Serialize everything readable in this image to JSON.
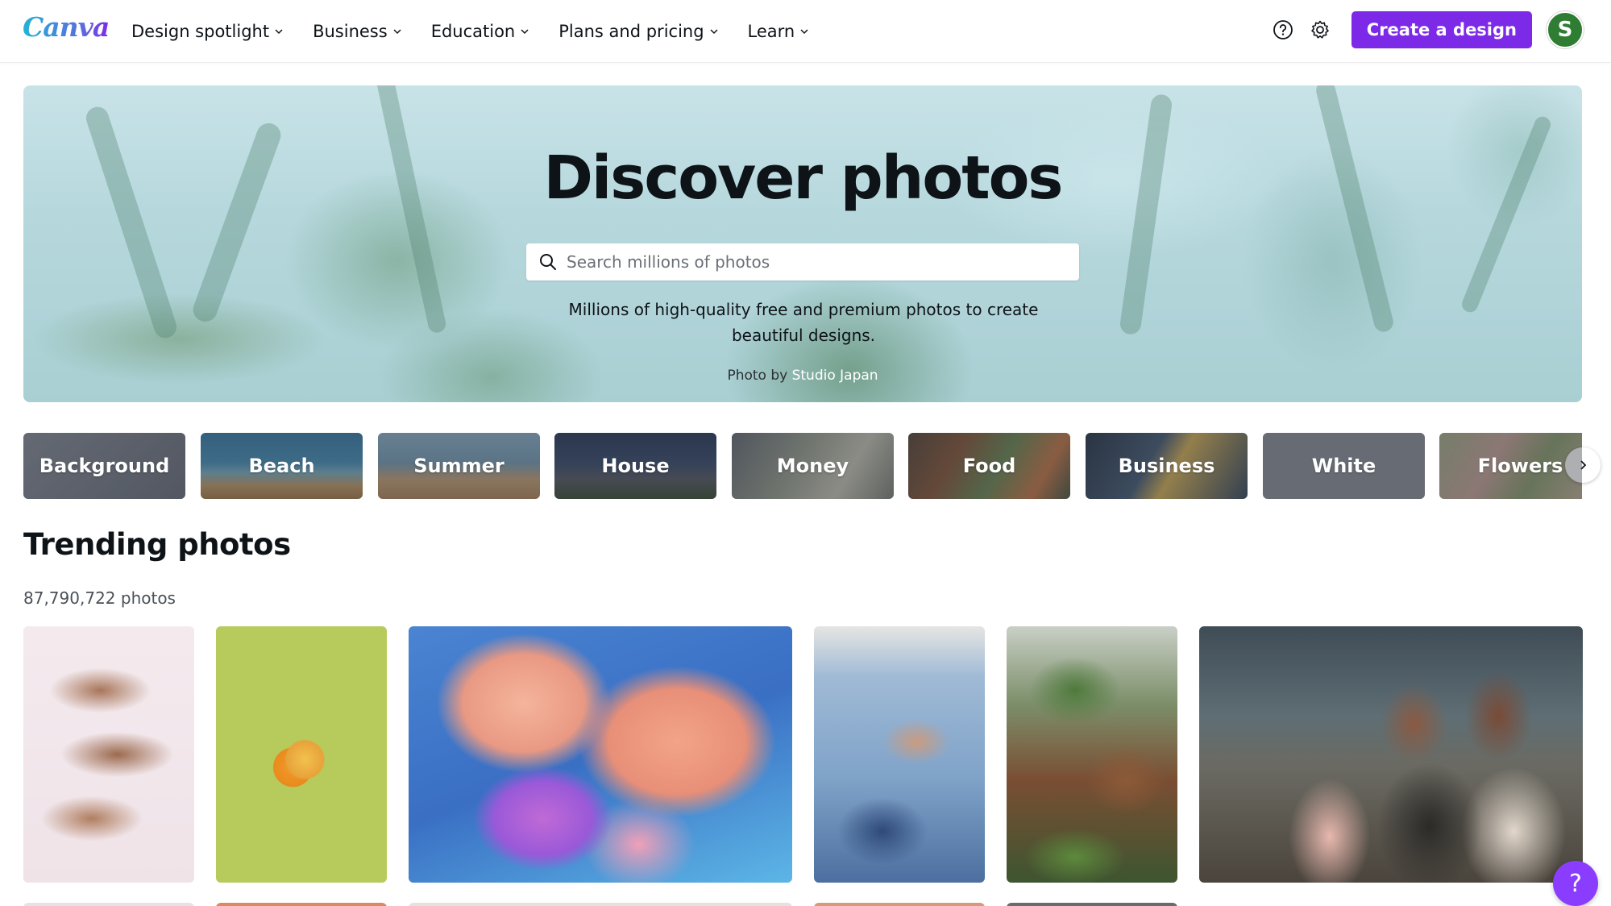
{
  "brand": {
    "logo_text": "Canva",
    "accent_color": "#7d2ae8"
  },
  "nav": {
    "items": [
      {
        "label": "Design spotlight"
      },
      {
        "label": "Business"
      },
      {
        "label": "Education"
      },
      {
        "label": "Plans and pricing"
      },
      {
        "label": "Learn"
      }
    ],
    "help_icon": "help-circle-icon",
    "settings_icon": "gear-icon",
    "create_label": "Create a design",
    "avatar_initial": "S"
  },
  "hero": {
    "title": "Discover photos",
    "search_placeholder": "Search millions of photos",
    "search_icon": "search-icon",
    "description": "Millions of high-quality free and premium photos to create beautiful designs.",
    "credit_prefix": "Photo by",
    "credit_author": "Studio Japan"
  },
  "categories": [
    {
      "label": "Background"
    },
    {
      "label": "Beach"
    },
    {
      "label": "Summer"
    },
    {
      "label": "House"
    },
    {
      "label": "Money"
    },
    {
      "label": "Food"
    },
    {
      "label": "Business"
    },
    {
      "label": "White"
    },
    {
      "label": "Flowers"
    }
  ],
  "trending": {
    "title": "Trending photos",
    "count": "87,790,722 photos"
  },
  "help_fab": "?"
}
